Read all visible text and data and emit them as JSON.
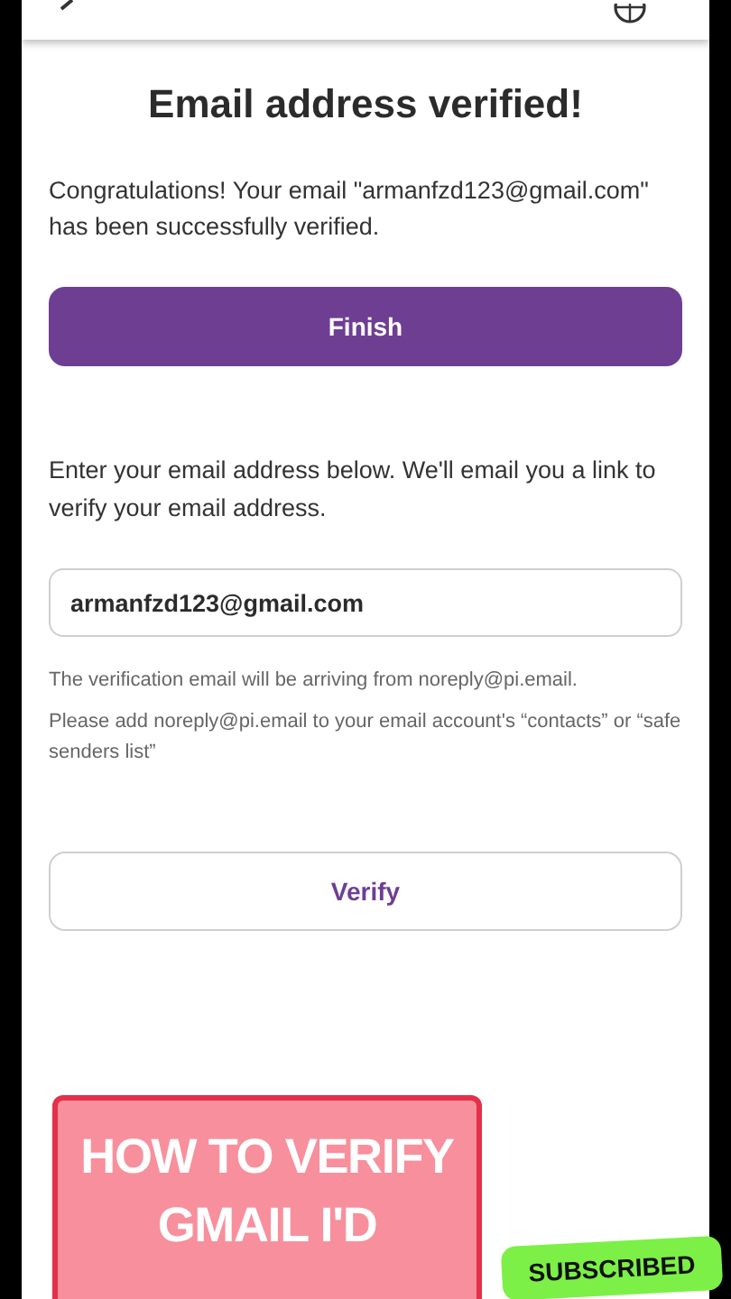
{
  "heading": "Email address verified!",
  "confirmation": "Congratulations! Your email \"armanfzd123@gmail.com\" has been successfully verified.",
  "finish_button": "Finish",
  "instructions": "Enter your email address below. We'll email you a link to verify your email address.",
  "email_field": {
    "value": "armanfzd123@gmail.com"
  },
  "notes": [
    "The verification email will be arriving from noreply@pi.email.",
    "Please add noreply@pi.email to your email account's “contacts” or “safe senders list”"
  ],
  "verify_button": "Verify",
  "overlay": {
    "title_lines": [
      "HOW TO VERIFY",
      "GMAIL I'D"
    ],
    "badge": "SUBSCRIBED"
  }
}
